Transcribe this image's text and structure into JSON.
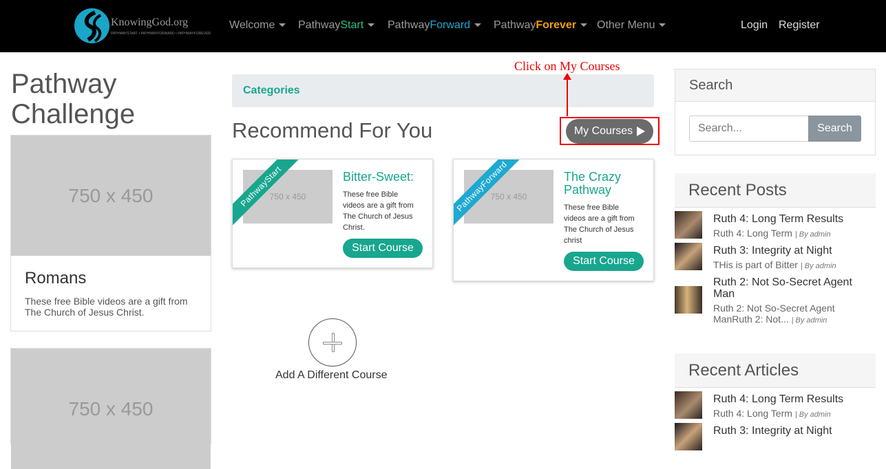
{
  "navbar": {
    "logo_text": "KnowingGod.org",
    "logo_tagline": "PATHWAYSTART • PATHWAYFORWARD • PATHWAYFOREVER",
    "menus": [
      {
        "label": "Welcome",
        "prefix": "Welcome",
        "suffix": "",
        "suffix_color": "#9a9a9a"
      },
      {
        "label": "PathwayStart",
        "prefix": "Pathway",
        "suffix": "Start",
        "suffix_color": "#2fbf83"
      },
      {
        "label": "PathwayForward",
        "prefix": "Pathway",
        "suffix": "Forward",
        "suffix_color": "#1ea9d1"
      },
      {
        "label": "PathwayForever",
        "prefix": "Pathway",
        "suffix": "Forever",
        "suffix_color": "#f39c12"
      },
      {
        "label": "Other Menu",
        "prefix": "Other Menu",
        "suffix": "",
        "suffix_color": "#9a9a9a"
      }
    ],
    "login": "Login",
    "register": "Register"
  },
  "left": {
    "title_line1": "Pathway",
    "title_line2": "Challenge",
    "cards": [
      {
        "placeholder": "750 x 450",
        "title": "Romans",
        "desc": "These free Bible videos are a gift from The Church of Jesus Christ."
      },
      {
        "placeholder": "750 x 450"
      }
    ]
  },
  "main": {
    "categories_label": "Categories",
    "recommend_title": "Recommend For You",
    "my_courses_label": "My Courses",
    "annotation": "Click on My Courses",
    "courses": [
      {
        "ribbon": "PathwayStart",
        "ribbon_color": "#18a68f",
        "thumb": "750 x 450",
        "title": "Bitter-Sweet:",
        "desc": "These free Bible videos are a gift from The Church of Jesus Christ.",
        "button": "Start Course"
      },
      {
        "ribbon": "PathwayForward",
        "ribbon_color": "#1ea9d1",
        "thumb": "750 x 450",
        "title": "The Crazy Pathway",
        "desc": "These free Bible videos are a gift from The Church of Jesus christ",
        "button": "Start Course"
      }
    ],
    "add_label": "Add A Different Course"
  },
  "sidebar": {
    "search_title": "Search",
    "search_placeholder": "Search...",
    "search_button": "Search",
    "recent_posts_title": "Recent Posts",
    "recent_posts": [
      {
        "title": "Ruth 4: Long Term Results",
        "excerpt": "Ruth 4: Long Term",
        "by": "| By admin"
      },
      {
        "title": "Ruth 3: Integrity at Night",
        "excerpt": "THis is part of Bitter",
        "by": "| By admin"
      },
      {
        "title": "Ruth 2: Not So-Secret Agent Man",
        "excerpt": "Ruth 2: Not So-Secret Agent ManRuth 2: Not...",
        "by": "| By admin"
      }
    ],
    "recent_articles_title": "Recent Articles",
    "recent_articles": [
      {
        "title": "Ruth 4: Long Term Results",
        "excerpt": "Ruth 4: Long Term",
        "by": "| By admin"
      },
      {
        "title": "Ruth 3: Integrity at Night"
      }
    ]
  }
}
